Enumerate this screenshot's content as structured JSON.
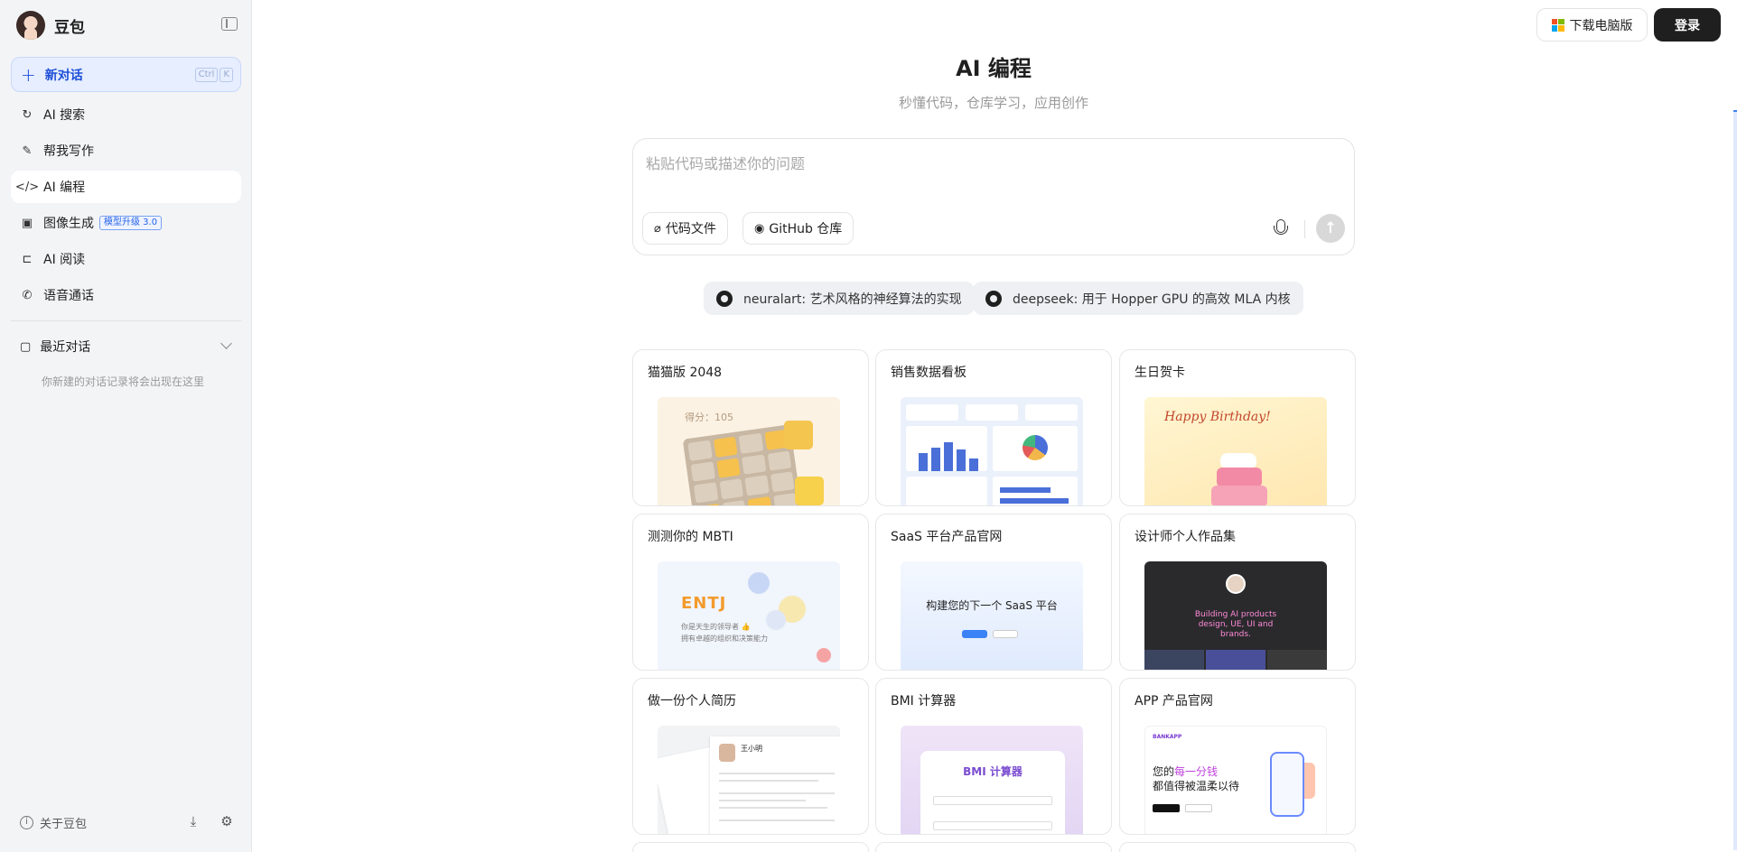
{
  "sidebar": {
    "brand_name": "豆包",
    "new_chat": {
      "label": "新对话",
      "shortcut": [
        "Ctrl",
        "K"
      ]
    },
    "items": [
      {
        "label": "AI 搜索",
        "icon": "search-refresh-icon"
      },
      {
        "label": "帮我写作",
        "icon": "pen-icon"
      },
      {
        "label": "AI 编程",
        "icon": "code-icon",
        "active": true
      },
      {
        "label": "图像生成",
        "icon": "image-icon",
        "badge": "模型升级 3.0"
      },
      {
        "label": "AI 阅读",
        "icon": "book-icon"
      },
      {
        "label": "语音通话",
        "icon": "phone-icon"
      }
    ],
    "recent": {
      "label": "最近对话",
      "empty_text": "你新建的对话记录将会出现在这里"
    },
    "footer": {
      "about_label": "关于豆包"
    }
  },
  "header": {
    "download_label": "下载电脑版",
    "login_label": "登录"
  },
  "main": {
    "title": "AI 编程",
    "subtitle": "秒懂代码，仓库学习，应用创作",
    "composer": {
      "placeholder": "粘贴代码或描述你的问题",
      "code_file_label": "代码文件",
      "github_label": "GitHub 仓库"
    },
    "repos": [
      {
        "label": "neuralart: 艺术风格的神经算法的实现"
      },
      {
        "label": "deepseek: 用于 Hopper GPU 的高效 MLA 内核"
      }
    ],
    "cards": [
      {
        "title": "猫猫版 2048",
        "thumb_text": "得分：105"
      },
      {
        "title": "销售数据看板"
      },
      {
        "title": "生日贺卡",
        "thumb_text": "Happy Birthday!"
      },
      {
        "title": "测测你的 MBTI",
        "thumb_text": "ENTJ",
        "thumb_sub": [
          "你是天生的领导者 👍",
          "拥有卓越的组织和决策能力"
        ]
      },
      {
        "title": "SaaS 平台产品官网",
        "thumb_text": "构建您的下一个 SaaS 平台"
      },
      {
        "title": "设计师个人作品集",
        "thumb_text": "Building AI products design, UE, UI and brands."
      },
      {
        "title": "做一份个人简历",
        "thumb_text": "王小明"
      },
      {
        "title": "BMI 计算器",
        "thumb_text": "BMI 计算器"
      },
      {
        "title": "APP 产品官网",
        "thumb_text": [
          "您的",
          "每一分钱",
          "都值得被温柔以待"
        ],
        "thumb_logo": "BANKAPP"
      }
    ]
  },
  "colors": {
    "accent": "#1d4ed8",
    "sidebar_bg": "#f3f4f6",
    "login_bg": "#1f1f1f"
  }
}
